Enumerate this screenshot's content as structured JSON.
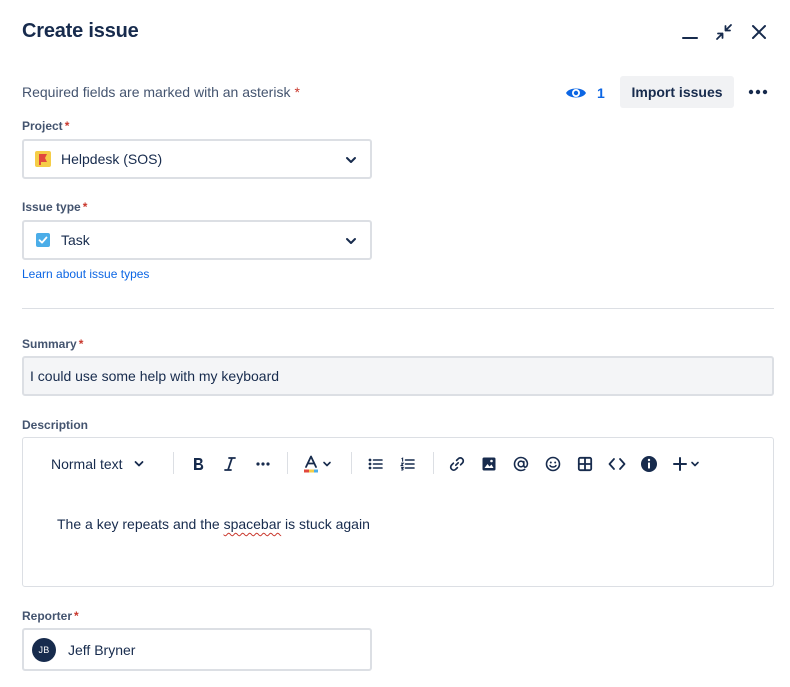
{
  "dialog": {
    "title": "Create issue"
  },
  "window_controls": [
    "minimize-icon",
    "collapse-icon",
    "close-icon"
  ],
  "header": {
    "required_note": "Required fields are marked with an asterisk",
    "asterisk": "*",
    "watchers_count": "1",
    "import_label": "Import issues",
    "more_icon": "more-icon"
  },
  "fields": {
    "project": {
      "label": "Project",
      "value": "Helpdesk (SOS)"
    },
    "issue_type": {
      "label": "Issue type",
      "value": "Task",
      "help_link": "Learn about issue types"
    },
    "summary": {
      "label": "Summary",
      "value": "I could use some help with my keyboard"
    },
    "description": {
      "label": "Description",
      "text_style": "Normal text",
      "body_before": "The a key repeats and the ",
      "body_misspelled": "spacebar",
      "body_after": " is stuck again"
    },
    "reporter": {
      "label": "Reporter",
      "initials": "JB",
      "name": "Jeff Bryner"
    }
  },
  "colors": {
    "text": "#172b4d",
    "subtle_text": "#44546f",
    "link": "#0c66e4",
    "required": "#c9372c",
    "border": "#dcdfe4"
  }
}
